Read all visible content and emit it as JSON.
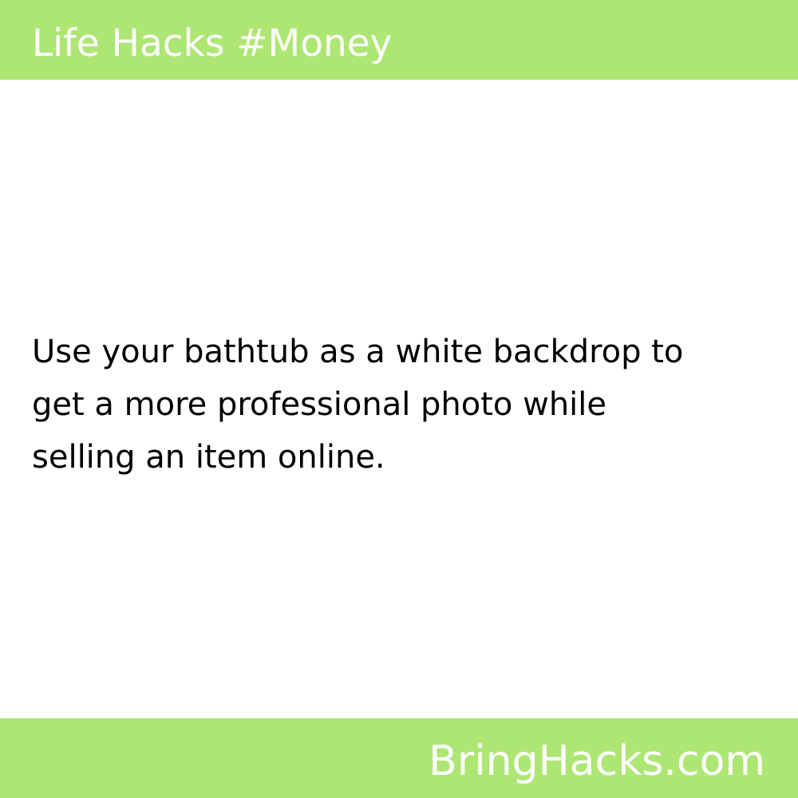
{
  "header": {
    "title": "Life Hacks #Money"
  },
  "tip": {
    "lines": [
      "Use your bathtub as a white backdrop to",
      "get a more professional photo while",
      "selling an item online."
    ]
  },
  "footer": {
    "brand": "BringHacks.com"
  },
  "colors": {
    "band": "#aee674",
    "band_text": "#ffffff",
    "body_text": "#000000",
    "background": "#ffffff"
  }
}
